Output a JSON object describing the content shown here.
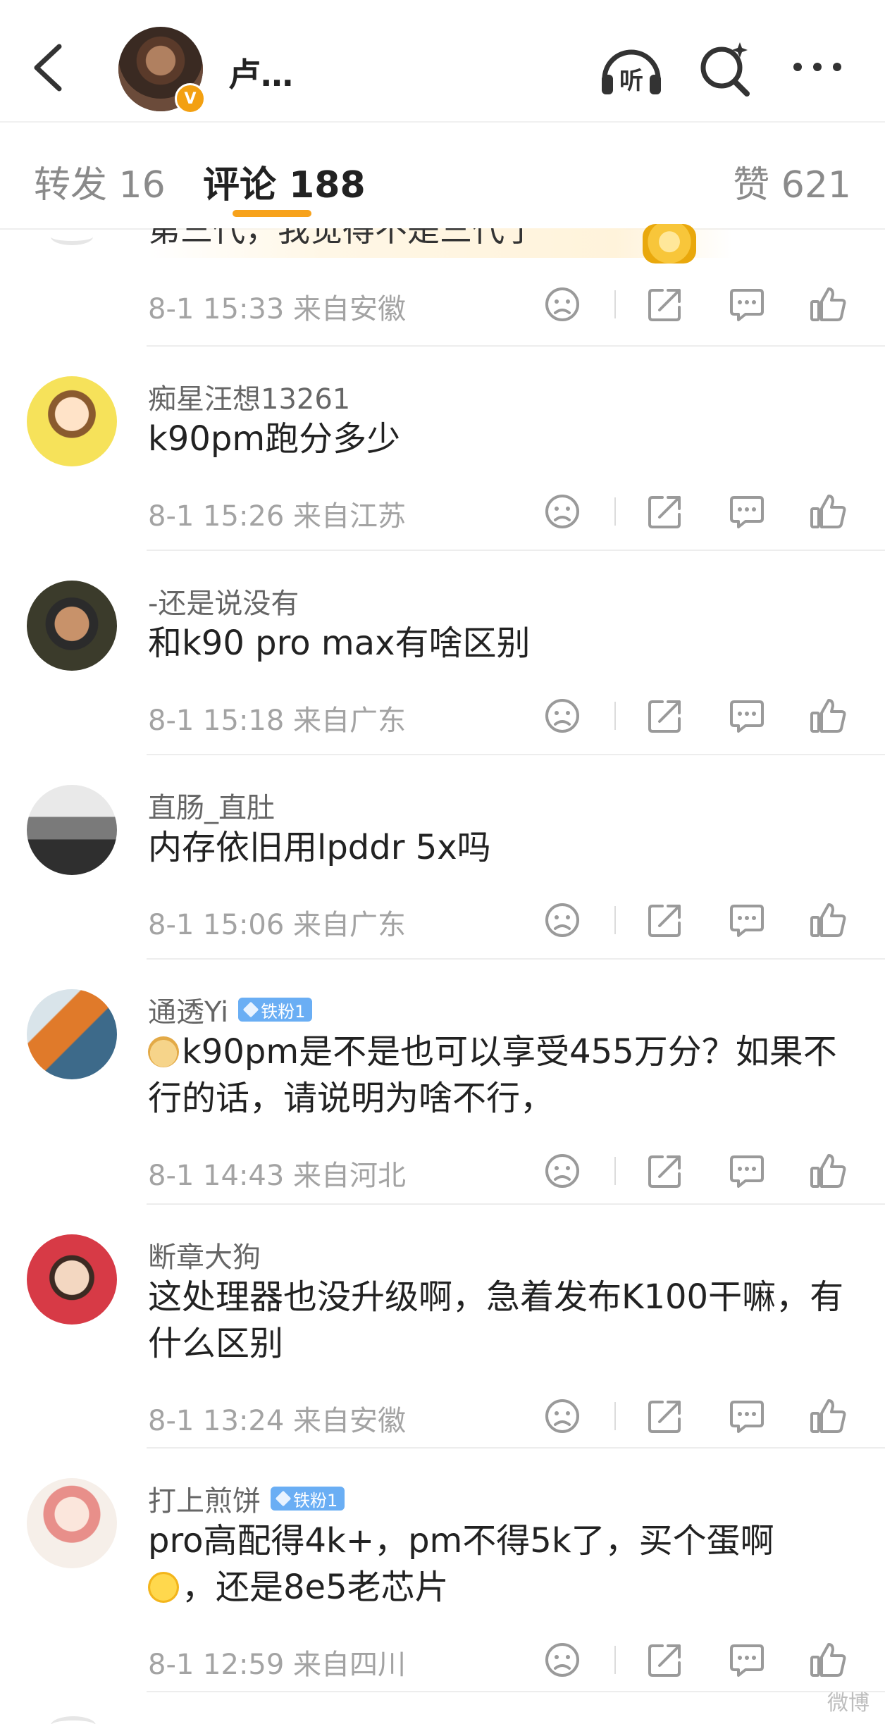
{
  "header": {
    "author_name": "卢…",
    "verified_badge": "V",
    "listen_label": "听",
    "icons": [
      "back-icon",
      "listen-icon",
      "ai-search-icon",
      "more-icon"
    ]
  },
  "tabs": {
    "repost": "转发 16",
    "comment": "评论 188",
    "like": "赞 621"
  },
  "partial_comment": {
    "text": "第三代，我觉得不是三代了",
    "meta": "8-1 15:33 来自安徽"
  },
  "comments": [
    {
      "name": "痴星汪想13261",
      "text": "k90pm跑分多少",
      "meta": "8-1 15:26 来自江苏"
    },
    {
      "name": "-还是说没有",
      "text": "和k90 pro max有啥区别",
      "meta": "8-1 15:18 来自广东"
    },
    {
      "name": "直肠_直肚",
      "text": "内存依旧用lpddr 5x吗",
      "meta": "8-1 15:06 来自广东"
    },
    {
      "name": "通透Yi",
      "badge": "铁粉1",
      "text": "k90pm是不是也可以享受455万分？如果不行的话，请说明为啥不行，",
      "meta": "8-1 14:43 来自河北"
    },
    {
      "name": "断章大狗",
      "text": "这处理器也没升级啊，急着发布K100干嘛，有什么区别",
      "meta": "8-1 13:24 来自安徽"
    },
    {
      "name": "打上煎饼",
      "badge": "铁粉1",
      "text_part1": "pro高配得4k+，pm不得5k了，买个蛋啊",
      "text_part2": "，还是8e5老芯片",
      "meta": "8-1 12:59 来自四川"
    }
  ],
  "watermark": "微博"
}
